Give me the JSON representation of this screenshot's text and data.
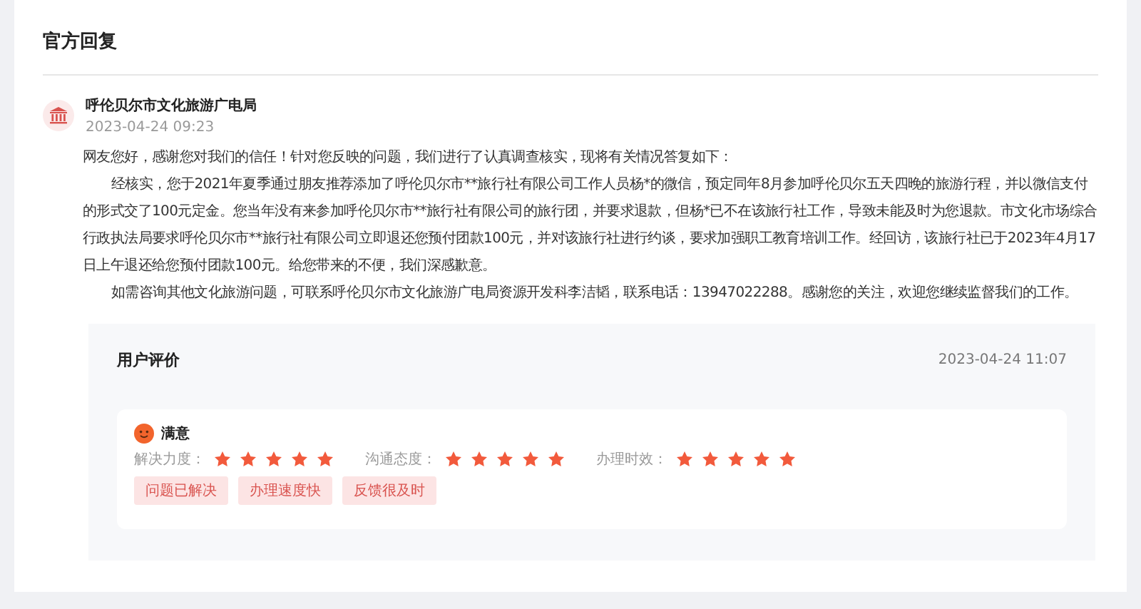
{
  "title": "官方回复",
  "reply": {
    "author": "呼伦贝尔市文化旅游广电局",
    "time": "2023-04-24 09:23",
    "paragraphs": [
      {
        "text": "网友您好，感谢您对我们的信任！针对您反映的问题，我们进行了认真调查核实，现将有关情况答复如下：",
        "indent": false
      },
      {
        "text": "经核实，您于2021年夏季通过朋友推荐添加了呼伦贝尔市**旅行社有限公司工作人员杨*的微信，预定同年8月参加呼伦贝尔五天四晚的旅游行程，并以微信支付的形式交了100元定金。您当年没有来参加呼伦贝尔市**旅行社有限公司的旅行团，并要求退款，但杨*已不在该旅行社工作，导致未能及时为您退款。市文化市场综合行政执法局要求呼伦贝尔市**旅行社有限公司立即退还您预付团款100元，并对该旅行社进行约谈，要求加强职工教育培训工作。经回访，该旅行社已于2023年4月17日上午退还给您预付团款100元。给您带来的不便，我们深感歉意。",
        "indent": true
      },
      {
        "text": "如需咨询其他文化旅游问题，可联系呼伦贝尔市文化旅游广电局资源开发科李洁韬，联系电话：13947022288。感谢您的关注，欢迎您继续监督我们的工作。",
        "indent": true
      }
    ]
  },
  "evaluation": {
    "title": "用户评价",
    "time": "2023-04-24 11:07",
    "mood": "满意",
    "ratings": [
      {
        "label": "解决力度：",
        "stars": 5
      },
      {
        "label": "沟通态度：",
        "stars": 5
      },
      {
        "label": "办理时效：",
        "stars": 5
      }
    ],
    "tags": [
      "问题已解决",
      "办理速度快",
      "反馈很及时"
    ]
  }
}
